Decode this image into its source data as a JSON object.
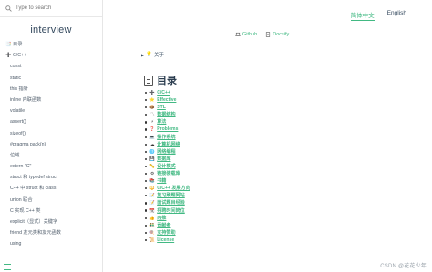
{
  "search": {
    "placeholder": "Type to search"
  },
  "sidebar": {
    "title": "interview",
    "items": [
      {
        "label": "目录",
        "icon": "📑",
        "top": true
      },
      {
        "label": "C/C++",
        "icon": "➕",
        "top": true
      },
      {
        "label": "const"
      },
      {
        "label": "static"
      },
      {
        "label": "this 指针"
      },
      {
        "label": "inline 内联函数"
      },
      {
        "label": "volatile"
      },
      {
        "label": "assert()"
      },
      {
        "label": "sizeof()"
      },
      {
        "label": "#pragma pack(n)"
      },
      {
        "label": "位域"
      },
      {
        "label": "extern \"C\""
      },
      {
        "label": "struct 和 typedef struct"
      },
      {
        "label": "C++ 中 struct 和 class"
      },
      {
        "label": "union 联合"
      },
      {
        "label": "C 实现 C++ 类"
      },
      {
        "label": "explicit（显式）关键字"
      },
      {
        "label": "friend 友元类和友元函数"
      },
      {
        "label": "using"
      }
    ]
  },
  "header": {
    "lang_active": "简体中文",
    "lang_other": "English"
  },
  "links": {
    "github": "Github",
    "docsify": "Docsify"
  },
  "content": {
    "about": "关于",
    "toc_title": "目录",
    "toc": [
      {
        "icon": "➕",
        "label": "C/C++"
      },
      {
        "icon": "⭐",
        "label": "Effective"
      },
      {
        "icon": "📦",
        "label": "STL"
      },
      {
        "icon": "〽",
        "label": "数据结构"
      },
      {
        "icon": "⚡",
        "label": "算法"
      },
      {
        "icon": "❓",
        "label": "Problems"
      },
      {
        "icon": "💻",
        "label": "操作系统"
      },
      {
        "icon": "☁",
        "label": "计算机网络"
      },
      {
        "icon": "🌐",
        "label": "网络编程"
      },
      {
        "icon": "💾",
        "label": "数据库"
      },
      {
        "icon": "📏",
        "label": "设计模式"
      },
      {
        "icon": "⚙",
        "label": "链接装载库"
      },
      {
        "icon": "📚",
        "label": "书籍"
      },
      {
        "icon": "🔱",
        "label": "C/C++ 发展方向"
      },
      {
        "icon": "📝",
        "label": "复习刷题网站"
      },
      {
        "icon": "📝",
        "label": "面试题目经验"
      },
      {
        "icon": "📆",
        "label": "招聘时间岗位"
      },
      {
        "icon": "👍",
        "label": "内推"
      },
      {
        "icon": "👬",
        "label": "贡献者"
      },
      {
        "icon": "🍭",
        "label": "支持赞助"
      },
      {
        "icon": "📜",
        "label": "License"
      }
    ]
  },
  "watermark": "CSDN @花花少年",
  "colors": {
    "accent": "#42b983",
    "text": "#34495e"
  }
}
